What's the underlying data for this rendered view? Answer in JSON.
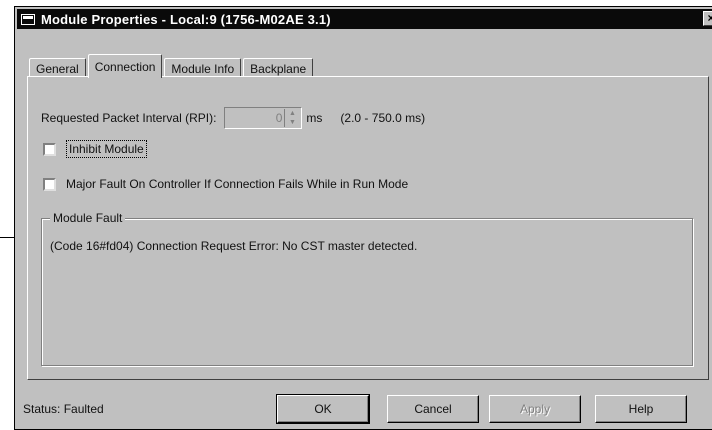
{
  "window": {
    "title": "Module Properties - Local:9 (1756-M02AE 3.1)",
    "close_glyph": "×"
  },
  "tabs": [
    {
      "label": "General",
      "active": false
    },
    {
      "label": "Connection",
      "active": true
    },
    {
      "label": "Module Info",
      "active": false
    },
    {
      "label": "Backplane",
      "active": false
    }
  ],
  "connection": {
    "rpi_label": "Requested Packet Interval (RPI):",
    "rpi_value": "0",
    "rpi_unit": "ms",
    "rpi_range": "(2.0 - 750.0 ms)",
    "inhibit_label": "Inhibit Module",
    "inhibit_checked": false,
    "major_fault_label": "Major Fault On Controller If Connection Fails While in Run Mode",
    "major_fault_checked": false
  },
  "module_fault": {
    "legend": "Module Fault",
    "text": "(Code 16#fd04) Connection Request Error: No CST master detected."
  },
  "status": {
    "label": "Status:",
    "value": "Faulted"
  },
  "buttons": {
    "ok": "OK",
    "cancel": "Cancel",
    "apply": "Apply",
    "help": "Help"
  },
  "icons": {
    "window": "window-icon",
    "spin_up": "▲",
    "spin_down": "▼"
  }
}
